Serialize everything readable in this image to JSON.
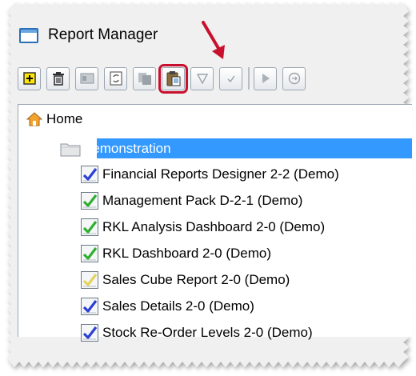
{
  "window": {
    "title": "Report Manager"
  },
  "toolbar": {
    "buttons": [
      {
        "name": "add-button",
        "icon": "add-icon"
      },
      {
        "name": "delete-button",
        "icon": "trash-icon"
      },
      {
        "name": "properties-button",
        "icon": "properties-icon"
      },
      {
        "name": "refresh-button",
        "icon": "refresh-icon"
      },
      {
        "name": "copy-button",
        "icon": "copy-icon"
      },
      {
        "name": "paste-button",
        "icon": "paste-icon",
        "highlighted": true
      },
      {
        "name": "filter-button",
        "icon": "filter-icon"
      },
      {
        "name": "check-button",
        "icon": "check-icon"
      },
      {
        "name": "run-button",
        "icon": "play-icon"
      },
      {
        "name": "publish-button",
        "icon": "publish-icon"
      }
    ]
  },
  "tree": {
    "home_label": "Home",
    "folder_label": "Demonstration",
    "reports": [
      {
        "label": "Financial Reports Designer 2-2 (Demo)",
        "check_color": "#2c3fd6"
      },
      {
        "label": "Management Pack D-2-1 (Demo)",
        "check_color": "#2fae2f"
      },
      {
        "label": "RKL Analysis Dashboard 2-0 (Demo)",
        "check_color": "#2fae2f"
      },
      {
        "label": "RKL Dashboard 2-0 (Demo)",
        "check_color": "#2fae2f"
      },
      {
        "label": "Sales Cube Report 2-0 (Demo)",
        "check_color": "#e3d35a"
      },
      {
        "label": "Sales Details 2-0 (Demo)",
        "check_color": "#2c3fd6"
      },
      {
        "label": "Stock Re-Order Levels 2-0 (Demo)",
        "check_color": "#2c3fd6"
      }
    ]
  },
  "colors": {
    "selection": "#3399ff",
    "highlight": "#c8102e",
    "accent": "#2a6fb8"
  }
}
